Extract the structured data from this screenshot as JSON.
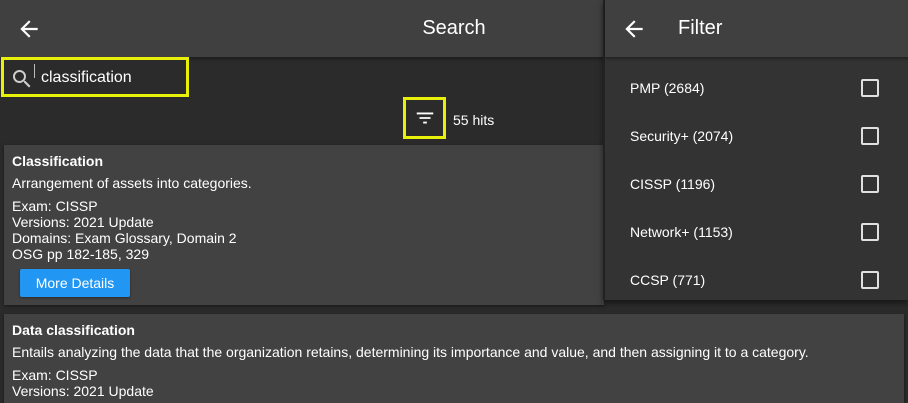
{
  "app_bar": {
    "title": "Search",
    "back_icon": "arrow-left-icon"
  },
  "search": {
    "value": "classification",
    "icon": "search-icon"
  },
  "results": {
    "hits_label": "55 hits",
    "filter_icon": "filter-list-icon",
    "cards": [
      {
        "title": "Classification",
        "description": "Arrangement of assets into categories.",
        "exam": "Exam: CISSP",
        "versions": "Versions: 2021 Update",
        "domains": "Domains: Exam Glossary, Domain 2",
        "osg": "OSG pp 182-185, 329",
        "button_label": "More Details"
      },
      {
        "title": "Data classification",
        "description": "Entails analyzing the data that the organization retains, determining its importance and value, and then assigning it to a category.",
        "exam": "Exam: CISSP",
        "versions": "Versions: 2021 Update"
      }
    ]
  },
  "filter_panel": {
    "title": "Filter",
    "back_icon": "arrow-left-icon",
    "items": [
      {
        "label": "PMP (2684)",
        "checked": false
      },
      {
        "label": "Security+ (2074)",
        "checked": false
      },
      {
        "label": "CISSP (1196)",
        "checked": false
      },
      {
        "label": "Network+ (1153)",
        "checked": false
      },
      {
        "label": "CCSP (771)",
        "checked": false
      }
    ]
  },
  "colors": {
    "highlight": "#e8f00a",
    "button": "#2196f3",
    "card": "#424242",
    "background": "#2b2b2b"
  }
}
